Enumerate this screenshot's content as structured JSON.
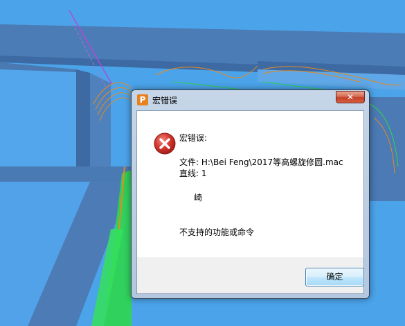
{
  "window": {
    "title": "宏错误",
    "close_symbol": "✕",
    "app_icon_letter": "P"
  },
  "message": {
    "heading": "宏错误:",
    "file_line": "文件: H:\\Bei Feng\\2017等高螺旋修圆.mac",
    "line_line": "直线: 1",
    "token": "崎",
    "description": "不支持的功能或命令"
  },
  "buttons": {
    "ok_label": "确定"
  },
  "icons": {
    "app": "powermill-p-icon",
    "error": "error-x-icon",
    "close": "close-icon"
  },
  "colors": {
    "viewport_background": "#4aa3e8",
    "model_face": "#4e7eb8",
    "toolpath_green": "#2fd64e",
    "toolpath_orange": "#e88a1e",
    "error_red": "#c9302c",
    "dialog_frame": "#b9cce3",
    "ok_button_border": "#3c7fb1"
  }
}
